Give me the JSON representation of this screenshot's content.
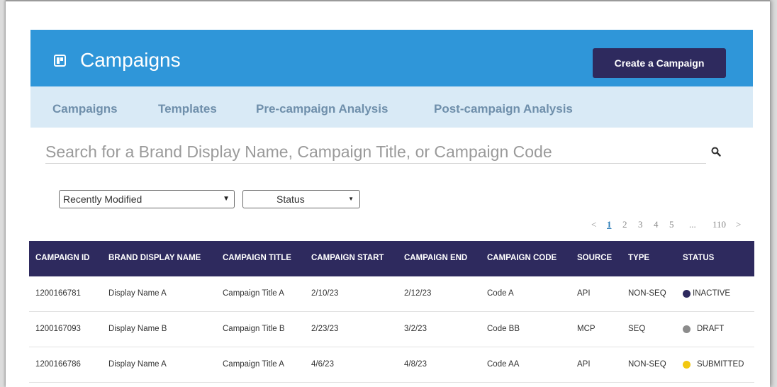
{
  "header": {
    "title": "Campaigns",
    "create_label": "Create a Campaign"
  },
  "tabs": [
    "Campaigns",
    "Templates",
    "Pre-campaign Analysis",
    "Post-campaign Analysis"
  ],
  "search": {
    "placeholder": "Search for a Brand Display Name, Campaign Title, or Campaign Code"
  },
  "filters": {
    "sort": "Recently Modified",
    "status": "Status"
  },
  "pagination": {
    "prev": "<",
    "pages": [
      "1",
      "2",
      "3",
      "4",
      "5"
    ],
    "ellipsis": "...",
    "last": "110",
    "next": ">",
    "current": "1"
  },
  "table": {
    "columns": [
      "CAMPAIGN ID",
      "BRAND DISPLAY NAME",
      "CAMPAIGN TITLE",
      "CAMPAIGN START",
      "CAMPAIGN END",
      "CAMPAIGN CODE",
      "SOURCE",
      "TYPE",
      "STATUS"
    ],
    "rows": [
      {
        "id": "1200166781",
        "brand": "Display Name A",
        "title": "Campaign Title A",
        "start": "2/10/23",
        "end": "2/12/23",
        "code": "Code A",
        "source": "API",
        "type": "NON-SEQ",
        "status": "INACTIVE",
        "status_color": "#2e2a5e"
      },
      {
        "id": "1200167093",
        "brand": "Display Name B",
        "title": "Campaign Title B",
        "start": "2/23/23",
        "end": "3/2/23",
        "code": "Code BB",
        "source": "MCP",
        "type": "SEQ",
        "status": "DRAFT",
        "status_color": "#8c8c8c"
      },
      {
        "id": "1200166786",
        "brand": "Display Name A",
        "title": "Campaign Title A",
        "start": "4/6/23",
        "end": "4/8/23",
        "code": "Code AA",
        "source": "API",
        "type": "NON-SEQ",
        "status": "SUBMITTED",
        "status_color": "#f2c811"
      }
    ]
  },
  "colors": {
    "header": "#2f96d9",
    "tabs_bg": "#d9eaf6",
    "table_header": "#2e2a5e",
    "button": "#2e2a5e"
  }
}
